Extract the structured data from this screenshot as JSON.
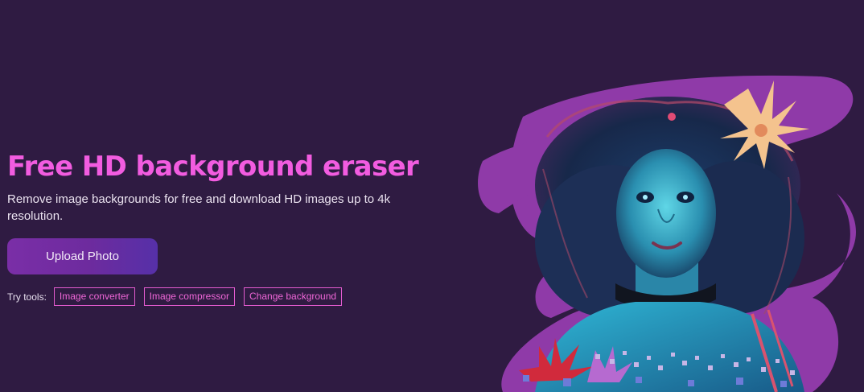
{
  "hero": {
    "title": "Free HD background eraser",
    "subtitle": "Remove image backgrounds for free and download HD images up to 4k resolution.",
    "upload_label": "Upload Photo"
  },
  "tools": {
    "label": "Try tools:",
    "items": [
      "Image converter",
      "Image compressor",
      "Change background"
    ]
  },
  "colors": {
    "background": "#2f1b42",
    "title_accent": "#f25ce0",
    "button": "#6d2b9e",
    "chip_border": "#e35bcf",
    "art_swoosh": "#8f3aa8"
  },
  "illustration": {
    "icon": "portrait-girl-with-flowers-illustration"
  }
}
